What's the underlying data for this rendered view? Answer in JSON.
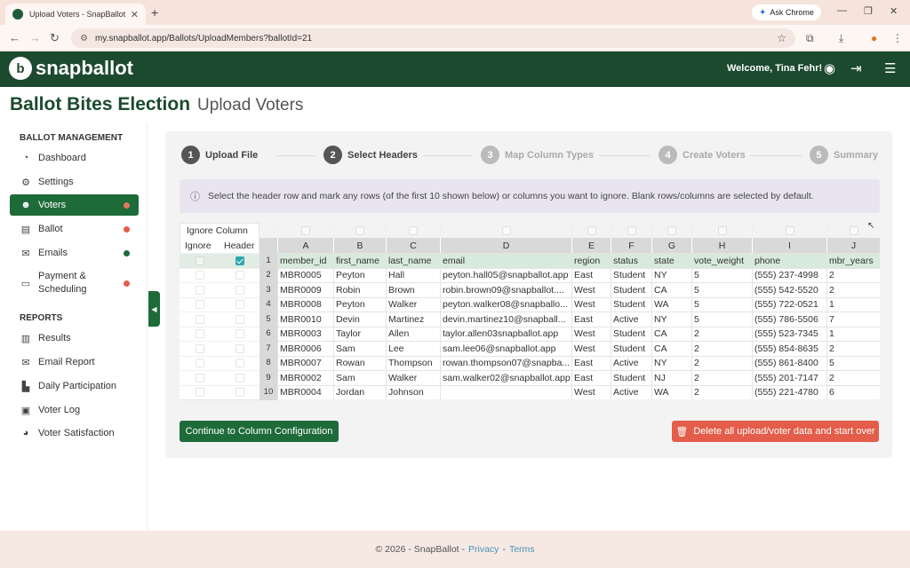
{
  "browser": {
    "tab_title": "Upload Voters - SnapBallot",
    "tab_close": "✕",
    "new_tab": "+",
    "ask_chrome": "Ask Chrome",
    "url": "my.snapballot.app/Ballots/UploadMembers?ballotId=21"
  },
  "header": {
    "logo_text": "snapballot",
    "welcome": "Welcome, Tina Fehr!"
  },
  "page": {
    "title": "Ballot Bites Election",
    "subtitle": "Upload Voters"
  },
  "sidebar": {
    "section_management": "BALLOT MANAGEMENT",
    "section_reports": "REPORTS",
    "items": [
      {
        "label": "Dashboard",
        "icon": "dashboard-icon",
        "dot": ""
      },
      {
        "label": "Settings",
        "icon": "gear-icon",
        "dot": ""
      },
      {
        "label": "Voters",
        "icon": "users-icon",
        "dot": "#e07a5a",
        "active": true
      },
      {
        "label": "Ballot",
        "icon": "ballot-icon",
        "dot": "#e35d4a"
      },
      {
        "label": "Emails",
        "icon": "mail-icon",
        "dot": "#1e6b3a"
      },
      {
        "label": "Payment &",
        "label2": "Scheduling",
        "icon": "credit-card-icon",
        "dot": "#e35d4a"
      }
    ],
    "reports": [
      {
        "label": "Results",
        "icon": "results-icon"
      },
      {
        "label": "Email Report",
        "icon": "mail-report-icon"
      },
      {
        "label": "Daily Participation",
        "icon": "chart-icon"
      },
      {
        "label": "Voter Log",
        "icon": "log-icon"
      },
      {
        "label": "Voter Satisfaction",
        "icon": "pie-icon"
      }
    ]
  },
  "steps": [
    {
      "num": "1",
      "label": "Upload File",
      "state": "done"
    },
    {
      "num": "2",
      "label": "Select Headers",
      "state": "done"
    },
    {
      "num": "3",
      "label": "Map Column Types",
      "state": "todo"
    },
    {
      "num": "4",
      "label": "Create Voters",
      "state": "todo"
    },
    {
      "num": "5",
      "label": "Summary",
      "state": "todo"
    }
  ],
  "info_text": "Select the header row and mark any rows (of the first 10 shown below) or columns you want to ignore. Blank rows/columns are selected by default.",
  "table": {
    "ignore_column_label": "Ignore Column",
    "ignore_label": "Ignore",
    "header_label": "Header",
    "col_letters": [
      "A",
      "B",
      "C",
      "D",
      "E",
      "F",
      "G",
      "H",
      "I",
      "J"
    ],
    "rows": [
      [
        "member_id",
        "first_name",
        "last_name",
        "email",
        "region",
        "status",
        "state",
        "vote_weight",
        "phone",
        "mbr_years"
      ],
      [
        "MBR0005",
        "Peyton",
        "Hall",
        "peyton.hall05@snapballot.app",
        "East",
        "Student",
        "NY",
        "5",
        "(555) 237-4998",
        "2"
      ],
      [
        "MBR0009",
        "Robin",
        "Brown",
        "robin.brown09@snapballot....",
        "West",
        "Student",
        "CA",
        "5",
        "(555) 542-5520",
        "2"
      ],
      [
        "MBR0008",
        "Peyton",
        "Walker",
        "peyton.walker08@snapballo...",
        "West",
        "Student",
        "WA",
        "5",
        "(555) 722-0521",
        "1"
      ],
      [
        "MBR0010",
        "Devin",
        "Martinez",
        "devin.martinez10@snapball...",
        "East",
        "Active",
        "NY",
        "5",
        "(555) 786-5506",
        "7"
      ],
      [
        "MBR0003",
        "Taylor",
        "Allen",
        "taylor.allen03snapballot.app",
        "West",
        "Student",
        "CA",
        "2",
        "(555) 523-7345",
        "1"
      ],
      [
        "MBR0006",
        "Sam",
        "Lee",
        "sam.lee06@snapballot.app",
        "West",
        "Student",
        "CA",
        "2",
        "(555) 854-8635",
        "2"
      ],
      [
        "MBR0007",
        "Rowan",
        "Thompson",
        "rowan.thompson07@snapba...",
        "East",
        "Active",
        "NY",
        "2",
        "(555) 861-8400",
        "5"
      ],
      [
        "MBR0002",
        "Sam",
        "Walker",
        "sam.walker02@snapballot.app",
        "East",
        "Student",
        "NJ",
        "2",
        "(555) 201-7147",
        "2"
      ],
      [
        "MBR0004",
        "Jordan",
        "Johnson",
        "",
        "West",
        "Active",
        "WA",
        "2",
        "(555) 221-4780",
        "6"
      ]
    ],
    "header_row_index": 0
  },
  "buttons": {
    "continue": "Continue to Column Configuration",
    "delete": "Delete all upload/voter data and start over"
  },
  "footer": {
    "copyright": "© 2026 - SnapBallot -",
    "privacy": "Privacy",
    "sep": "-",
    "terms": "Terms"
  },
  "colors": {
    "brand_green": "#1c4a2e",
    "active_green": "#1e6b3a",
    "danger": "#e35d4a",
    "checkbox_teal": "#2ca6b0"
  }
}
